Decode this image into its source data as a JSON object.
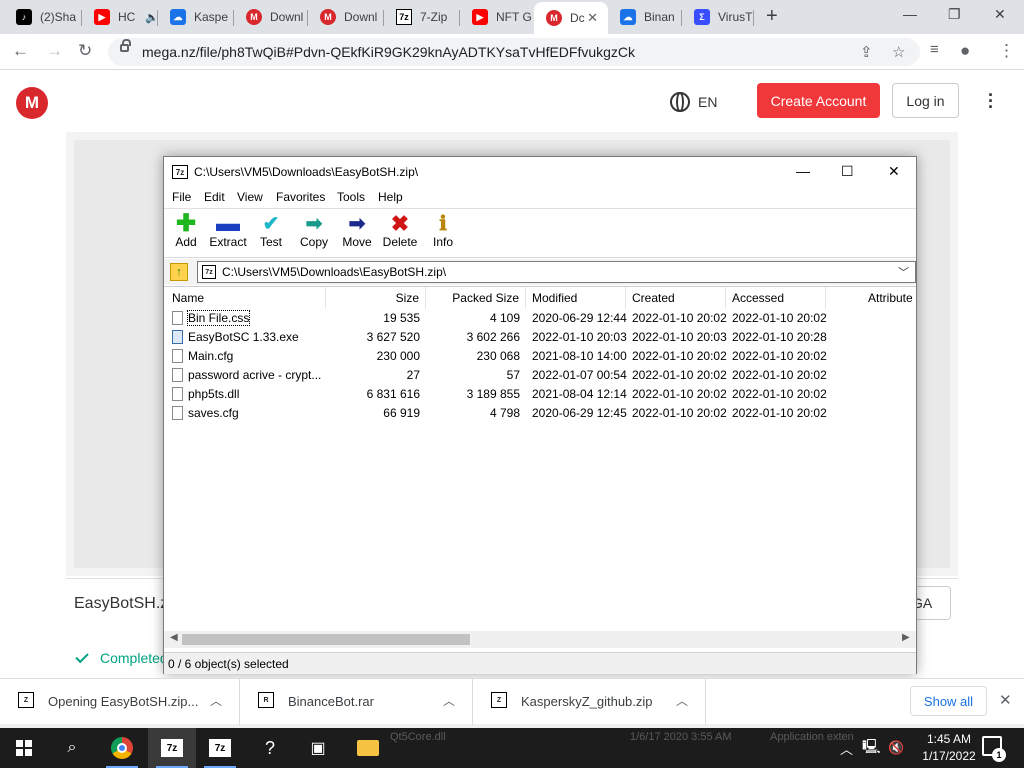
{
  "browser": {
    "tabs": [
      {
        "label": "(2)Sha",
        "icon": "tiktok-icon",
        "color": "#000000"
      },
      {
        "label": "HC",
        "icon": "youtube-icon",
        "color": "#ff0000"
      },
      {
        "label": "Kaspe",
        "icon": "cloud-icon",
        "color": "#1a73e8"
      },
      {
        "label": "Downl",
        "icon": "mega-icon",
        "color": "#d9272e"
      },
      {
        "label": "Downl",
        "icon": "mega-icon",
        "color": "#d9272e"
      },
      {
        "label": "7-Zip",
        "icon": "7zip-icon",
        "color": "#000000"
      },
      {
        "label": "NFT G",
        "icon": "youtube-icon",
        "color": "#ff0000"
      },
      {
        "label": "Dc",
        "icon": "mega-icon",
        "color": "#d9272e"
      },
      {
        "label": "Binan",
        "icon": "cloud-icon",
        "color": "#1a73e8"
      },
      {
        "label": "VirusT",
        "icon": "virustotal-icon",
        "color": "#394eff"
      }
    ],
    "url": "mega.nz/file/ph8TwQiB#Pdvn-QEkfKiR9GK29knAyADTKYsaTvHfEDFfvukgzCk"
  },
  "mega": {
    "logo": "M",
    "lang": "EN",
    "create_account": "Create Account",
    "login": "Log in",
    "file_name": "EasyBotSH.zi",
    "button_tail": "GA",
    "status": "Completed",
    "brand_color": "#d9272e"
  },
  "zip": {
    "title": "C:\\Users\\VM5\\Downloads\\EasyBotSH.zip\\",
    "menu": [
      "File",
      "Edit",
      "View",
      "Favorites",
      "Tools",
      "Help"
    ],
    "toolbar": [
      {
        "label": "Add",
        "icon": "add-icon"
      },
      {
        "label": "Extract",
        "icon": "extract-icon"
      },
      {
        "label": "Test",
        "icon": "test-icon"
      },
      {
        "label": "Copy",
        "icon": "copy-icon"
      },
      {
        "label": "Move",
        "icon": "move-icon"
      },
      {
        "label": "Delete",
        "icon": "delete-icon"
      },
      {
        "label": "Info",
        "icon": "info-icon"
      }
    ],
    "address": "C:\\Users\\VM5\\Downloads\\EasyBotSH.zip\\",
    "columns": [
      "Name",
      "Size",
      "Packed Size",
      "Modified",
      "Created",
      "Accessed",
      "Attribute"
    ],
    "rows": [
      {
        "name": "Bin File.css",
        "size": "19 535",
        "packed": "4 109",
        "modified": "2020-06-29 12:44",
        "created": "2022-01-10 20:02",
        "accessed": "2022-01-10 20:02",
        "type": "css"
      },
      {
        "name": "EasyBotSC 1.33.exe",
        "size": "3 627 520",
        "packed": "3 602 266",
        "modified": "2022-01-10 20:03",
        "created": "2022-01-10 20:03",
        "accessed": "2022-01-10 20:28",
        "type": "exe"
      },
      {
        "name": "Main.cfg",
        "size": "230 000",
        "packed": "230 068",
        "modified": "2021-08-10 14:00",
        "created": "2022-01-10 20:02",
        "accessed": "2022-01-10 20:02",
        "type": "file"
      },
      {
        "name": "password acrive - crypt...",
        "size": "27",
        "packed": "57",
        "modified": "2022-01-07 00:54",
        "created": "2022-01-10 20:02",
        "accessed": "2022-01-10 20:02",
        "type": "file"
      },
      {
        "name": "php5ts.dll",
        "size": "6 831 616",
        "packed": "3 189 855",
        "modified": "2021-08-04 12:14",
        "created": "2022-01-10 20:02",
        "accessed": "2022-01-10 20:02",
        "type": "dll"
      },
      {
        "name": "saves.cfg",
        "size": "66 919",
        "packed": "4 798",
        "modified": "2020-06-29 12:45",
        "created": "2022-01-10 20:02",
        "accessed": "2022-01-10 20:02",
        "type": "file"
      }
    ],
    "status": "0 / 6 object(s) selected"
  },
  "downloads": {
    "items": [
      {
        "label": "Opening EasyBotSH.zip..."
      },
      {
        "label": "BinanceBot.rar"
      },
      {
        "label": "KasperskyZ_github.zip"
      }
    ],
    "show_all": "Show all"
  },
  "taskbar": {
    "time": "1:45 AM",
    "date": "1/17/2022",
    "notifications": "1",
    "bg_text_1": "Qt5Core.dll",
    "bg_text_2": "1/6/17 2020 3:55 AM",
    "bg_text_3": "Application exten"
  }
}
